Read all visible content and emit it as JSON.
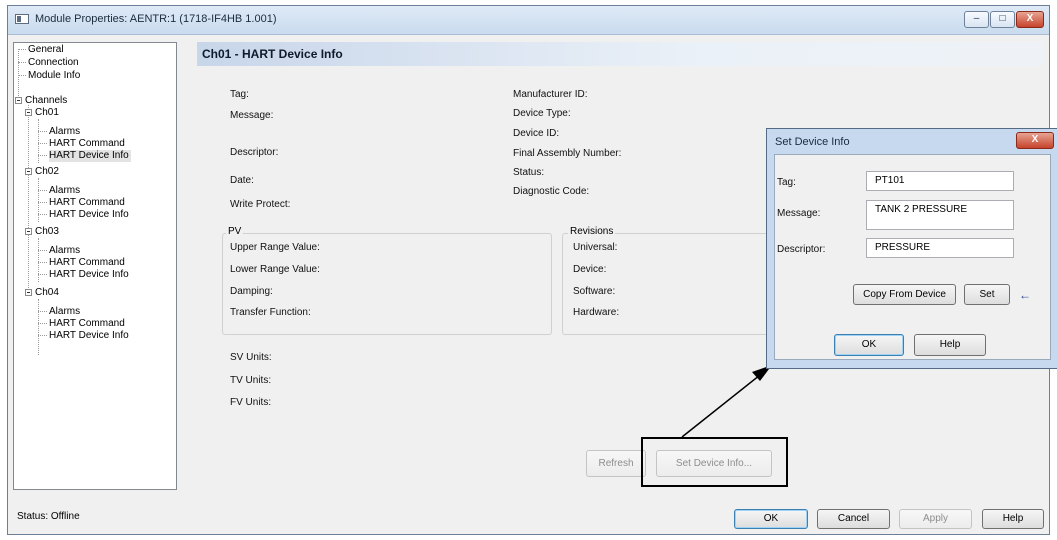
{
  "window": {
    "title": "Module Properties: AENTR:1 (1718-IF4HB 1.001)",
    "minimize_label": "–",
    "maximize_label": "□",
    "close_label": "X"
  },
  "tree": {
    "general": "General",
    "connection": "Connection",
    "module_info": "Module Info",
    "channels": "Channels",
    "channels_list": [
      {
        "name": "Ch01",
        "alarms": "Alarms",
        "hart_command": "HART Command",
        "hart_device_info": "HART Device Info"
      },
      {
        "name": "Ch02",
        "alarms": "Alarms",
        "hart_command": "HART Command",
        "hart_device_info": "HART Device Info"
      },
      {
        "name": "Ch03",
        "alarms": "Alarms",
        "hart_command": "HART Command",
        "hart_device_info": "HART Device Info"
      },
      {
        "name": "Ch04",
        "alarms": "Alarms",
        "hart_command": "HART Command",
        "hart_device_info": "HART Device Info"
      }
    ]
  },
  "page": {
    "title": "Ch01 - HART Device Info",
    "left_labels": {
      "tag": "Tag:",
      "message": "Message:",
      "descriptor": "Descriptor:",
      "date": "Date:",
      "write_protect": "Write Protect:"
    },
    "right_labels": {
      "manufacturer_id": "Manufacturer ID:",
      "device_type": "Device Type:",
      "device_id": "Device ID:",
      "final_assembly_number": "Final Assembly Number:",
      "status": "Status:",
      "diagnostic_code": "Diagnostic Code:"
    },
    "pv_group": {
      "title": "PV",
      "upper_range_value": "Upper Range Value:",
      "lower_range_value": "Lower Range Value:",
      "damping": "Damping:",
      "transfer_function": "Transfer Function:"
    },
    "revisions_group": {
      "title": "Revisions",
      "universal": "Universal:",
      "device": "Device:",
      "software": "Software:",
      "hardware": "Hardware:"
    },
    "units": {
      "sv": "SV Units:",
      "tv": "TV Units:",
      "fv": "FV Units:"
    },
    "refresh_label": "Refresh",
    "set_device_info_label": "Set Device Info..."
  },
  "statusbar": {
    "status": "Status:  Offline"
  },
  "footer_buttons": {
    "ok": "OK",
    "cancel": "Cancel",
    "apply": "Apply",
    "help": "Help"
  },
  "dialog": {
    "title": "Set Device Info",
    "close_label": "X",
    "tag_label": "Tag:",
    "tag_value": "PT101",
    "message_label": "Message:",
    "message_value": "TANK 2 PRESSURE",
    "descriptor_label": "Descriptor:",
    "descriptor_value": "PRESSURE",
    "copy_from_device_label": "Copy From Device",
    "set_label": "Set",
    "set_arrow": "←",
    "ok_label": "OK",
    "help_label": "Help"
  },
  "colors": {
    "title_gradient_start": "#c8d6ea",
    "dialog_frame": "#c7d9ee",
    "close_button": "#c6432b"
  }
}
